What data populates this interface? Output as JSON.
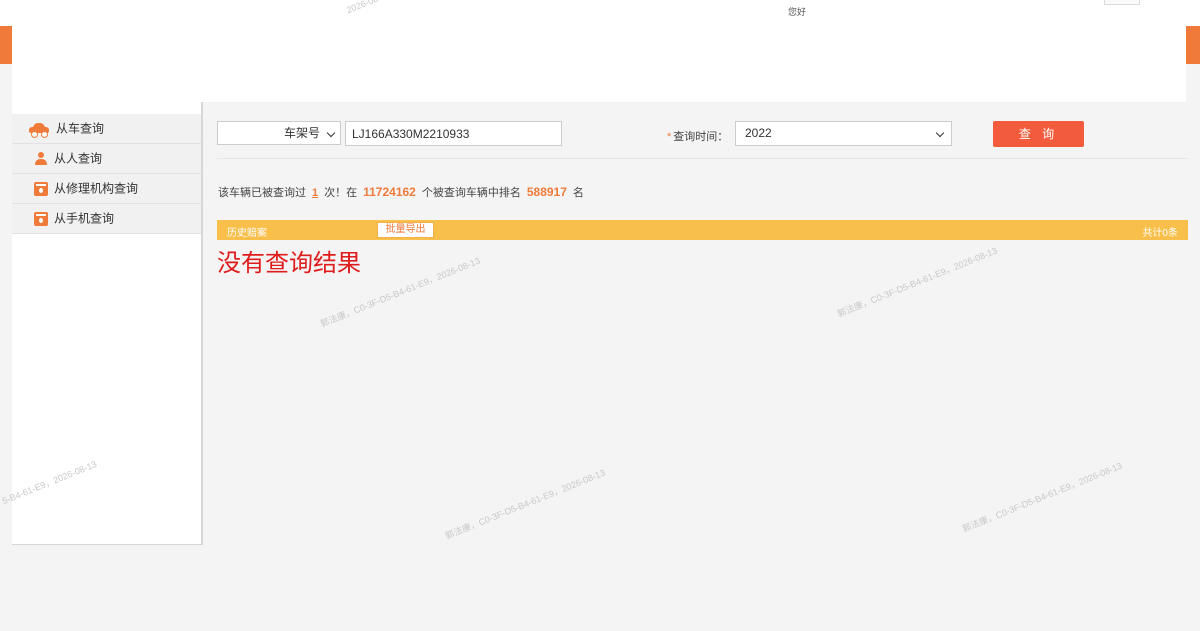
{
  "header": {
    "greeting": "您好"
  },
  "sidebar": {
    "items": [
      {
        "label": "从车查询",
        "icon": "car-icon"
      },
      {
        "label": "从人查询",
        "icon": "person-icon"
      },
      {
        "label": "从修理机构查询",
        "icon": "repair-shop-icon"
      },
      {
        "label": "从手机查询",
        "icon": "phone-icon"
      }
    ]
  },
  "search": {
    "field_selected": "车架号",
    "vin_value": "LJ166A330M2210933",
    "time_label": "查询时间：",
    "time_required_mark": "*",
    "year_selected": "2022",
    "query_button": "查 询"
  },
  "stats": {
    "prefix": "该车辆已被查询过",
    "times": "1",
    "mid1": "次！在",
    "total_vehicles": "11724162",
    "mid2": "个被查询车辆中排名",
    "rank": "588917",
    "suffix": "名"
  },
  "results": {
    "title": "历史赔案",
    "export_button": "批量导出",
    "total": "共计0条",
    "empty_message": "没有查询结果"
  },
  "watermarks": [
    {
      "text": "郭法康，C0-3F-D5-B4-61-E9，2026-08-13"
    },
    {
      "text": "郭法康，C0-3F-D5-B4-61-E9，2026-08-13"
    },
    {
      "text": "郭法康，C0-3F-D5-B4-61-E9，2026-08-13"
    },
    {
      "text": "郭法康，C0-3F-D5-B4-61-E9，2026-08-13"
    },
    {
      "text": "5-B4-61-E9，2026-08-13"
    },
    {
      "text": "2026-08-1"
    }
  ],
  "colors": {
    "accent": "#f07a3a",
    "button": "#f25c3c",
    "result_bar": "#f8bf4a",
    "empty_text": "#e01b1b"
  }
}
